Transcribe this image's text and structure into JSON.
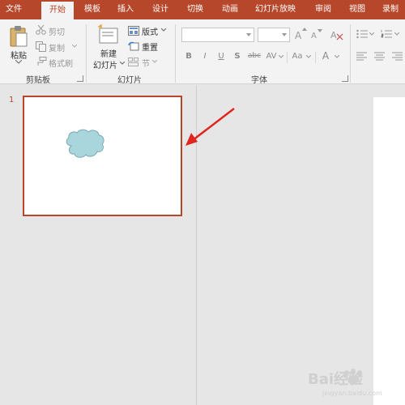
{
  "tabs": [
    {
      "label": "文件",
      "active": false
    },
    {
      "label": "开始",
      "active": true
    },
    {
      "label": "模板",
      "active": false
    },
    {
      "label": "插入",
      "active": false
    },
    {
      "label": "设计",
      "active": false
    },
    {
      "label": "切换",
      "active": false
    },
    {
      "label": "动画",
      "active": false
    },
    {
      "label": "幻灯片放映",
      "active": false
    },
    {
      "label": "审阅",
      "active": false
    },
    {
      "label": "视图",
      "active": false
    },
    {
      "label": "录制",
      "active": false
    }
  ],
  "clipboard": {
    "paste": "粘贴",
    "cut": "剪切",
    "copy": "复制",
    "format_painter": "格式刷",
    "group_label": "剪贴板"
  },
  "slides_group": {
    "new_slide_line1": "新建",
    "new_slide_line2": "幻灯片",
    "layout": "版式",
    "reset": "重置",
    "section": "节",
    "group_label": "幻灯片"
  },
  "font_group": {
    "font_name_value": "",
    "font_size_value": "",
    "grow": "A",
    "shrink": "A",
    "bold": "B",
    "italic": "I",
    "underline": "U",
    "shadow": "S",
    "strikethrough": "abc",
    "spacing": "AV",
    "change_case": "Aa",
    "font_color": "A",
    "group_label": "字体"
  },
  "thumbnails": {
    "slide_number": "1"
  },
  "watermark": {
    "text": "Bai经验",
    "sub": "jingyan.baidu.com"
  },
  "colors": {
    "accent": "#b7472a",
    "cloud_fill": "#a9d5dd",
    "arrow": "#e0261f"
  }
}
